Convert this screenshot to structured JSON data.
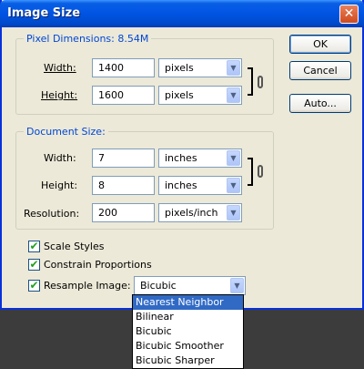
{
  "window": {
    "title": "Image Size",
    "close_symbol": "✕"
  },
  "pixel_dimensions": {
    "legend": "Pixel Dimensions:  8.54M",
    "width_label": "Width:",
    "width_value": "1400",
    "width_unit": "pixels",
    "height_label": "Height:",
    "height_value": "1600",
    "height_unit": "pixels"
  },
  "document_size": {
    "legend": "Document Size:",
    "width_label": "Width:",
    "width_value": "7",
    "width_unit": "inches",
    "height_label": "Height:",
    "height_value": "8",
    "height_unit": "inches",
    "resolution_label": "Resolution:",
    "resolution_value": "200",
    "resolution_unit": "pixels/inch"
  },
  "buttons": {
    "ok": "OK",
    "cancel": "Cancel",
    "auto": "Auto..."
  },
  "options": {
    "scale_styles": {
      "label": "Scale Styles",
      "checked": true
    },
    "constrain_proportions": {
      "label": "Constrain Proportions",
      "checked": true
    },
    "resample_image": {
      "label": "Resample Image:",
      "checked": true,
      "value": "Bicubic"
    }
  },
  "resample_dropdown": {
    "items": [
      "Nearest Neighbor",
      "Bilinear",
      "Bicubic",
      "Bicubic Smoother",
      "Bicubic Sharper"
    ],
    "highlighted": "Nearest Neighbor"
  },
  "check_glyph": "✔",
  "arrow_glyph": "▼"
}
